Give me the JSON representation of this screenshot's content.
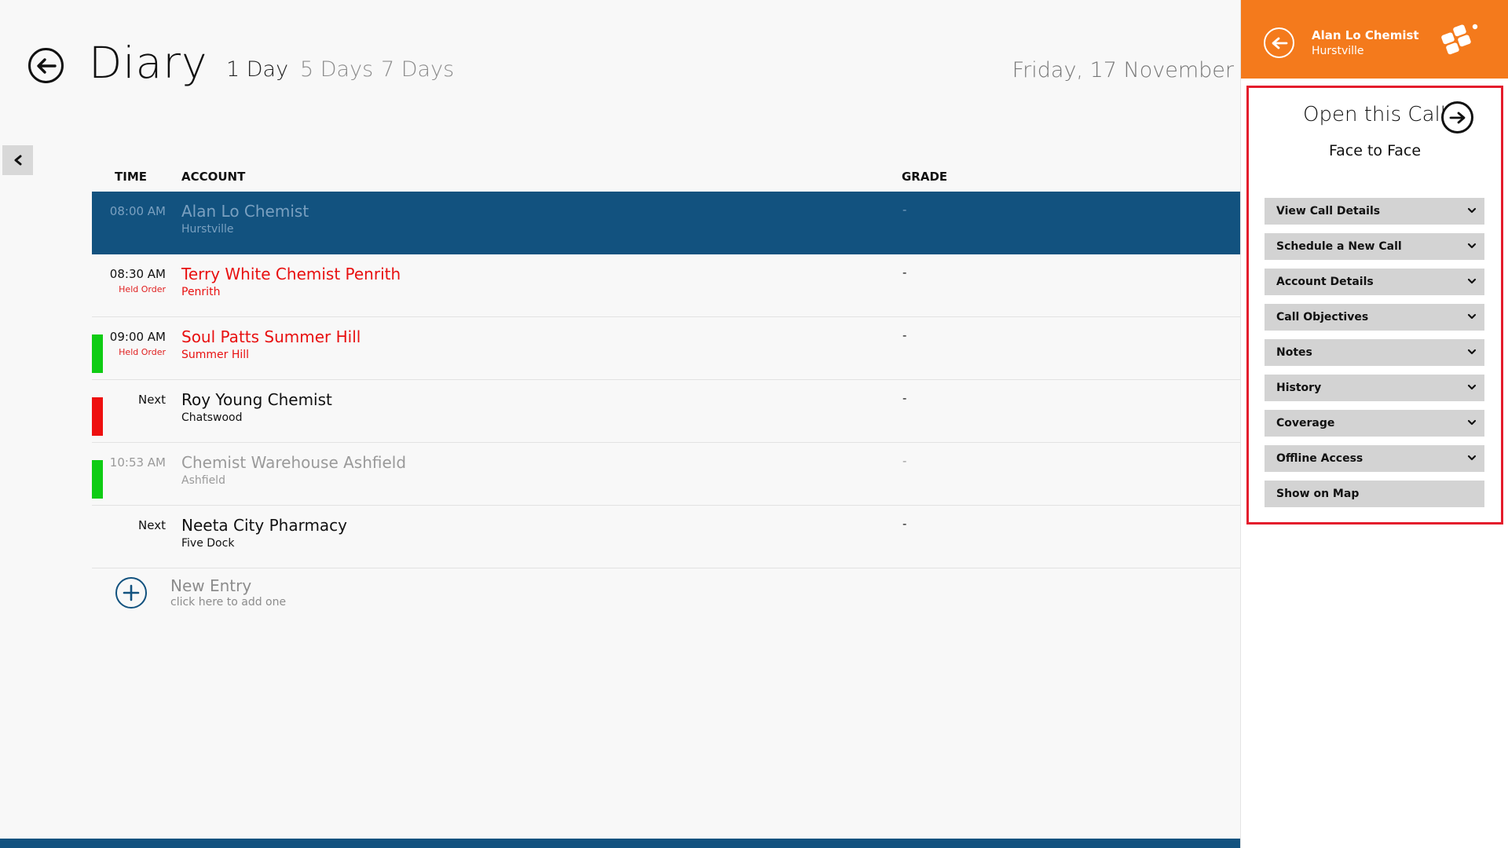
{
  "header": {
    "title": "Diary",
    "tabs": [
      {
        "label": "1 Day",
        "active": true
      },
      {
        "label": "5 Days",
        "active": false
      },
      {
        "label": "7 Days",
        "active": false
      }
    ],
    "date": "Friday, 17 November"
  },
  "table": {
    "columns": {
      "time": "TIME",
      "account": "ACCOUNT",
      "grade": "GRADE"
    },
    "rows": [
      {
        "time": "08:00 AM",
        "status": "",
        "account": "Alan Lo Chemist",
        "location": "Hurstville",
        "grade": "-",
        "bar": "",
        "style": "selected"
      },
      {
        "time": "08:30 AM",
        "status": "Held Order",
        "account": "Terry White Chemist Penrith",
        "location": "Penrith",
        "grade": "-",
        "bar": "",
        "style": "red"
      },
      {
        "time": "09:00 AM",
        "status": "Held Order",
        "account": "Soul Patts Summer Hill",
        "location": "Summer Hill",
        "grade": "-",
        "bar": "#0fcc14",
        "style": "red"
      },
      {
        "time": "Next",
        "status": "",
        "account": "Roy Young Chemist",
        "location": "Chatswood",
        "grade": "-",
        "bar": "#ee1010",
        "style": "normal"
      },
      {
        "time": "10:53 AM",
        "status": "",
        "account": "Chemist Warehouse Ashfield",
        "location": "Ashfield",
        "grade": "-",
        "bar": "#0fcc14",
        "style": "muted"
      },
      {
        "time": "Next",
        "status": "",
        "account": "Neeta City Pharmacy",
        "location": "Five Dock",
        "grade": "-",
        "bar": "",
        "style": "normal"
      }
    ]
  },
  "new_entry": {
    "title": "New Entry",
    "subtitle": "click here to add one"
  },
  "panel": {
    "account": "Alan Lo Chemist",
    "location": "Hurstville",
    "open_call": "Open this Call",
    "call_type": "Face to Face",
    "menu": [
      {
        "label": "View Call Details",
        "chevron": true
      },
      {
        "label": "Schedule a New Call",
        "chevron": true
      },
      {
        "label": "Account Details",
        "chevron": true
      },
      {
        "label": "Call Objectives",
        "chevron": true
      },
      {
        "label": "Notes",
        "chevron": true
      },
      {
        "label": "History",
        "chevron": true
      },
      {
        "label": "Coverage",
        "chevron": true
      },
      {
        "label": "Offline Access",
        "chevron": true
      },
      {
        "label": "Show on Map",
        "chevron": false
      }
    ]
  },
  "icons": {
    "back": "back-arrow-icon",
    "collapse": "chevron-left-icon",
    "add": "plus-circle-icon",
    "forward": "forward-arrow-icon",
    "menu_chevron": "chevron-down-icon",
    "logo": "app-logo-icon"
  },
  "colors": {
    "accent_blue": "#12527f",
    "panel_orange": "#f47a1c",
    "alert_red": "#e81010",
    "status_green": "#0fcc14",
    "highlight_red": "#e41c2c"
  }
}
